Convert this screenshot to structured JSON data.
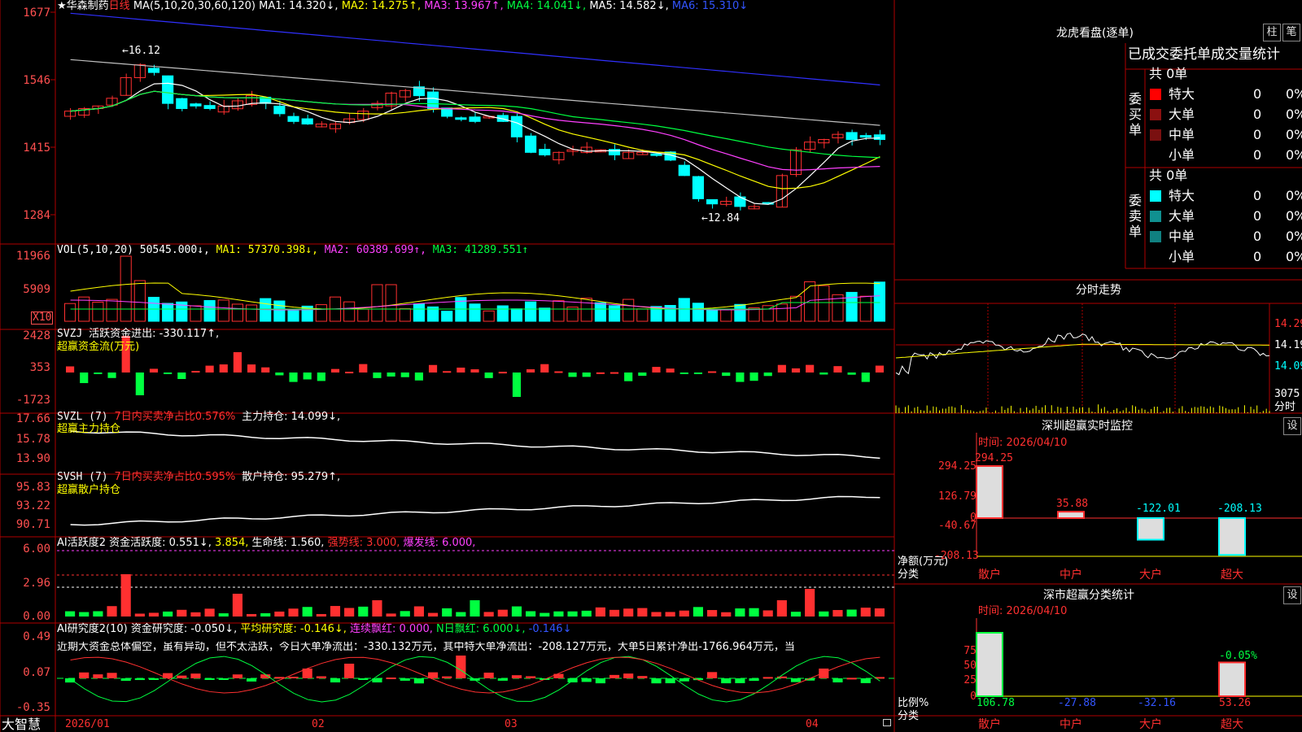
{
  "stock": {
    "star": "★",
    "name": "华森制药",
    "period": "日线",
    "ma_label": "MA(5,10,20,30,60,120)",
    "ma1": "MA1: 14.320↓,",
    "ma2": "MA2: 14.275↑,",
    "ma3": "MA3: 13.967↑,",
    "ma4": "MA4: 14.041↓,",
    "ma5": "MA5: 14.582↓,",
    "ma6": "MA6: 15.310↓",
    "high_mark": "16.12",
    "low_mark": "12.84"
  },
  "price_axis": [
    "1677",
    "1546",
    "1415",
    "1284"
  ],
  "volume": {
    "label": "VOL(5,10,20)",
    "value": "50545.000↓,",
    "ma1": "MA1: 57370.398↓,",
    "ma2": "MA2: 60389.699↑,",
    "ma3": "MA3: 41289.551↑",
    "axis": [
      "11966",
      "5909"
    ],
    "unit": "X10"
  },
  "svzj": {
    "label": "SVZJ",
    "text": "活跃资金进出: -330.117↑,",
    "title": "超赢资金流(万元)",
    "axis": [
      "2428",
      "353",
      "-1723"
    ]
  },
  "svzl": {
    "label": "SVZL (7)",
    "ratio": "7日内买卖净占比0.576%",
    "hold": "主力持仓: 14.099↓,",
    "title": "超赢主力持仓",
    "axis": [
      "17.66",
      "15.78",
      "13.90"
    ]
  },
  "svsh": {
    "label": "SVSH (7)",
    "ratio": "7日内买卖净占比0.595%",
    "hold": "散户持仓: 95.279↑,",
    "title": "超赢散户持仓",
    "axis": [
      "95.83",
      "93.22",
      "90.71"
    ]
  },
  "ai_active": {
    "label": "AI活跃度2",
    "a": "资金活跃度: 0.551↓,",
    "b": "3.854,",
    "c": "生命线: 1.560,",
    "d": "强势线: 3.000,",
    "e": "爆发线: 6.000,",
    "axis": [
      "6.00",
      "2.96",
      "0.00"
    ]
  },
  "ai_research": {
    "label": "AI研究度2(10)",
    "a": "资金研究度: -0.050↓,",
    "b": "平均研究度: -0.146↓,",
    "c": "连续飘红: 0.000,",
    "d": "N日飘红: 6.000↓,",
    "e": "-0.146↓",
    "comment": "近期大资金总体偏空，虽有异动，但不太活跃，今日大单净流出：-330.132万元，其中特大单净流出：-208.127万元，大单5日累计净出-1766.964万元，当",
    "axis": [
      "0.49",
      "0.07",
      "-0.35"
    ]
  },
  "dates": [
    "2026/01",
    "02",
    "03",
    "04"
  ],
  "brand": "大智慧",
  "right": {
    "panel_title": "龙虎看盘(逐单)",
    "btn_zhu": "柱",
    "btn_bi": "笔",
    "subtitle": "已成交委托单成交量统计",
    "buy_label": "委买单",
    "sell_label": "委卖单",
    "buy_total": "共 0单",
    "sell_total": "共 0单",
    "rows": [
      "特大",
      "大单",
      "中单",
      "小单"
    ],
    "zero": "0",
    "pct": "0%",
    "buy_colors": [
      "#ff0000",
      "#8b1010",
      "#7a1010",
      "#000000"
    ],
    "sell_colors": [
      "#00ffff",
      "#109090",
      "#108080",
      "#000000"
    ]
  },
  "intraday": {
    "title": "分时走势",
    "axis": [
      "14.29",
      "14.19",
      "14.09"
    ],
    "vol_axis": [
      "3075",
      "分时"
    ]
  },
  "monitor": {
    "title": "深圳超赢实时监控",
    "btn": "设",
    "time": "时间: 2026/04/10",
    "axis": [
      "294.25",
      "126.79",
      "0",
      "-40.67",
      "-208.13"
    ],
    "ylabel1": "净额(万元)",
    "ylabel2": "分类",
    "categories": [
      "散户",
      "中户",
      "大户",
      "超大"
    ],
    "values": [
      294.25,
      35.88,
      -122.01,
      -208.13
    ],
    "labels": [
      "294.25",
      "35.88",
      "-122.01",
      "-208.13"
    ]
  },
  "classify": {
    "title": "深市超赢分类统计",
    "btn": "设",
    "time": "时间: 2026/04/10",
    "axis": [
      "75",
      "50",
      "25",
      "0"
    ],
    "ylabel1": "比例%",
    "ylabel2": "分类",
    "categories": [
      "散户",
      "中户",
      "大户",
      "超大"
    ],
    "labels": [
      "106.78",
      "-27.88",
      "-32.16",
      "53.26"
    ],
    "bar_pct": [
      "",
      "",
      "",
      "-0.05%"
    ],
    "values": [
      106.78,
      -27.88,
      -32.16,
      53.26
    ]
  },
  "colors": {
    "up": "#ff3030",
    "down": "#00ffff",
    "grid": "#b00000",
    "ma1": "#ffffff",
    "ma2": "#ffff00",
    "ma3": "#ff40ff",
    "ma4": "#00ff40",
    "ma5": "#c0c0c0",
    "ma6": "#3030ff"
  }
}
